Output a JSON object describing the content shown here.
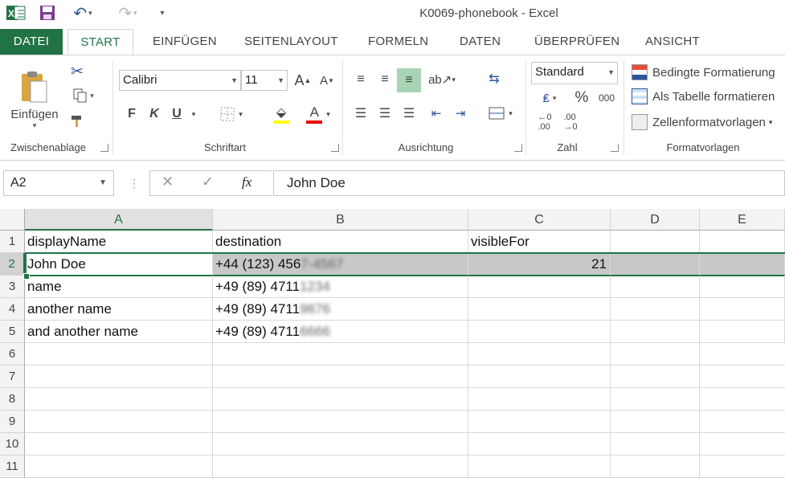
{
  "window": {
    "title": "K0069-phonebook - Excel"
  },
  "tabs": [
    {
      "label": "DATEI"
    },
    {
      "label": "START"
    },
    {
      "label": "EINFÜGEN"
    },
    {
      "label": "SEITENLAYOUT"
    },
    {
      "label": "FORMELN"
    },
    {
      "label": "DATEN"
    },
    {
      "label": "ÜBERPRÜFEN"
    },
    {
      "label": "ANSICHT"
    }
  ],
  "ribbon": {
    "clipboard": {
      "paste_label": "Einfügen",
      "group_label": "Zwischenablage"
    },
    "font": {
      "font_name": "Calibri",
      "font_size": "11",
      "bold": "F",
      "italic": "K",
      "underline": "U",
      "group_label": "Schriftart"
    },
    "alignment": {
      "group_label": "Ausrichtung"
    },
    "number": {
      "format": "Standard",
      "percent": "%",
      "thousands": "000",
      "group_label": "Zahl"
    },
    "styles": {
      "conditional": "Bedingte Formatierung",
      "as_table": "Als Tabelle formatieren",
      "cell_styles": "Zellenformatvorlagen",
      "group_label": "Formatvorlagen"
    }
  },
  "formula_bar": {
    "name_box": "A2",
    "fx": "fx",
    "value": "John Doe"
  },
  "sheet": {
    "columns": [
      "A",
      "B",
      "C",
      "D",
      "E"
    ],
    "rows": [
      "1",
      "2",
      "3",
      "4",
      "5",
      "6",
      "7",
      "8",
      "9",
      "10",
      "11"
    ],
    "cells": {
      "r1": {
        "a": "displayName",
        "b": "destination",
        "c": "visibleFor"
      },
      "r2": {
        "a": "John Doe",
        "b": "+44 (123) 456",
        "b_blur": "7-4567",
        "c": "21"
      },
      "r3": {
        "a": "name",
        "b": "+49 (89) 4711",
        "b_blur": "1234"
      },
      "r4": {
        "a": "another name",
        "b": "+49 (89) 4711",
        "b_blur": "9876"
      },
      "r5": {
        "a": "and another name",
        "b": "+49 (89) 4711",
        "b_blur": "6666"
      }
    }
  },
  "colors": {
    "accent": "#217346",
    "selection_fill": "#c8c8c8"
  }
}
